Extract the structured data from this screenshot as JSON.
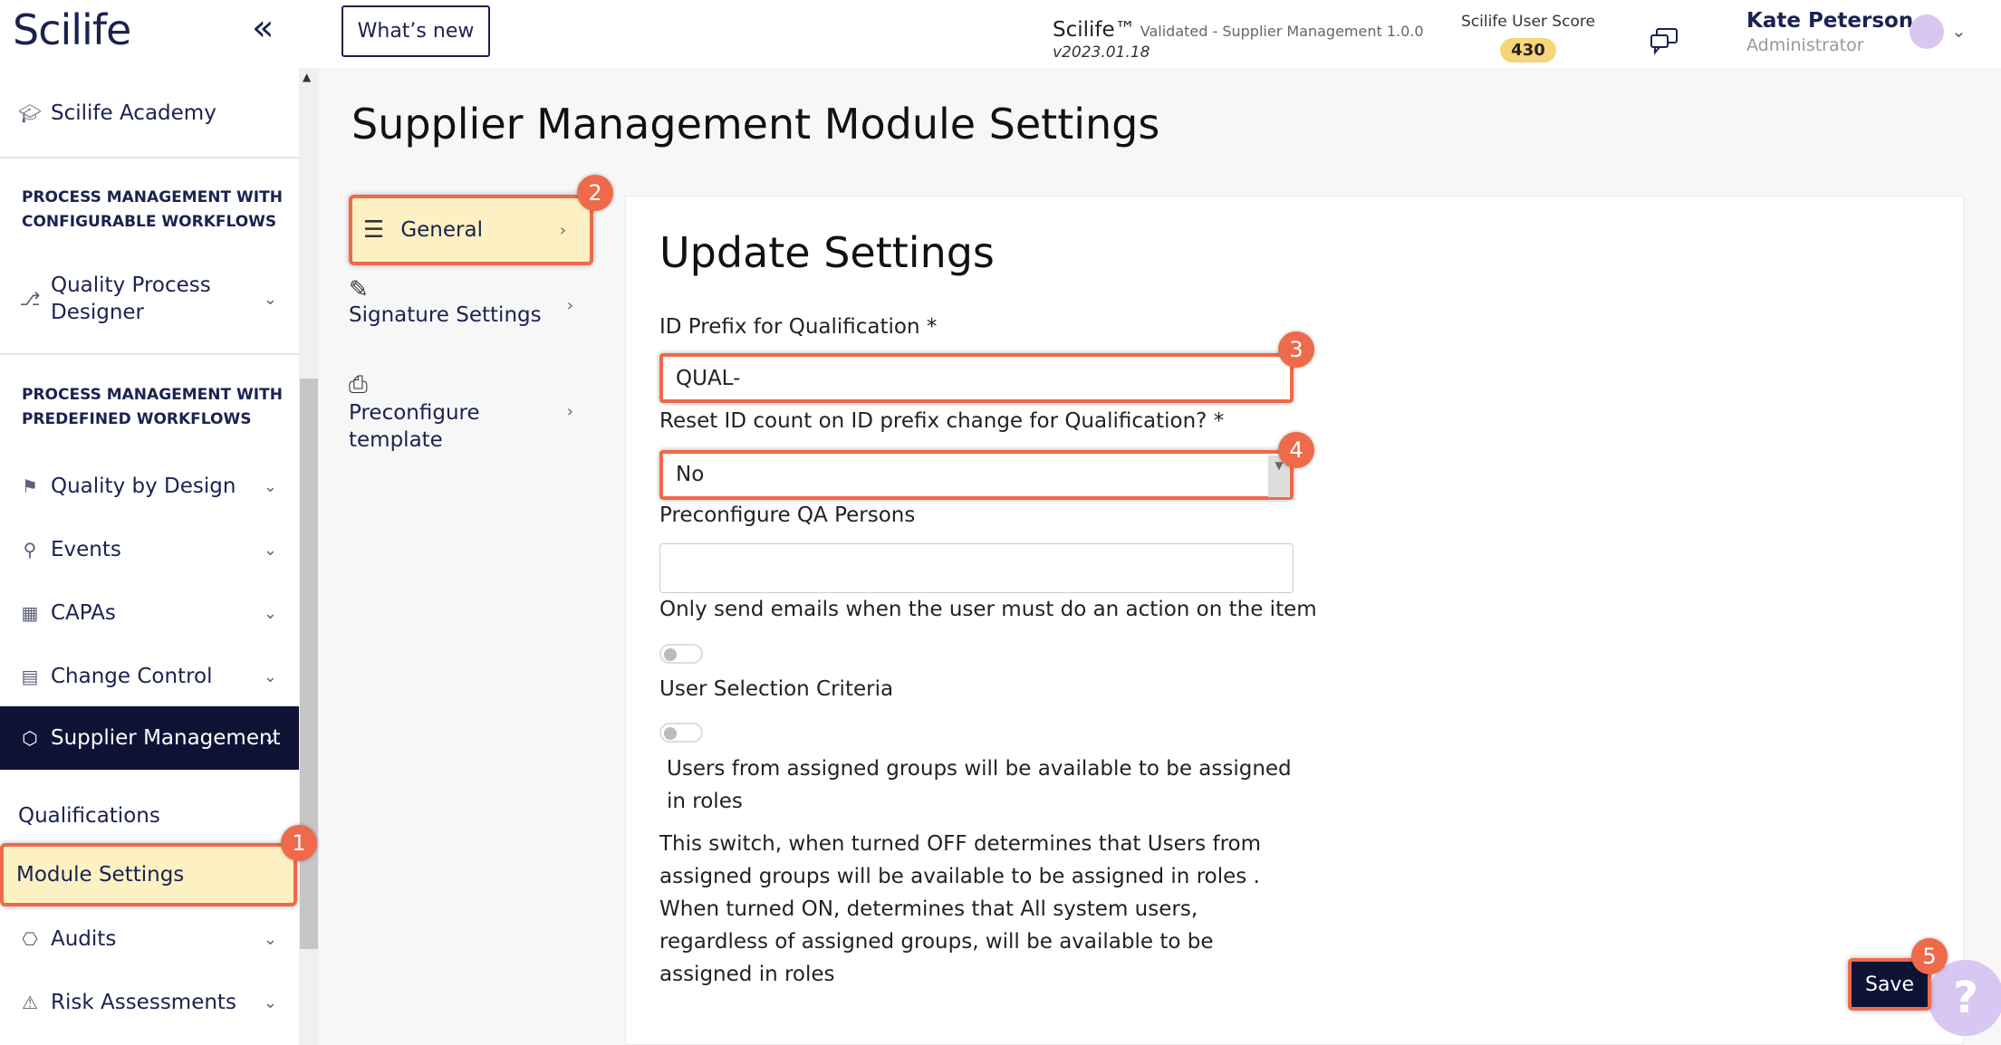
{
  "header": {
    "logo": "Scilife",
    "collapse_icon": "double-chevron-left-icon",
    "whats_new": "What’s new",
    "product_name": "Scilife™",
    "product_sub": "Validated - Supplier Management 1.0.0",
    "product_version": "v2023.01.18",
    "score_label": "Scilife User Score",
    "score_value": "430",
    "user_name": "Kate Peterson",
    "user_role": "Administrator"
  },
  "sidebar": {
    "academy": "Scilife Academy",
    "section1": "PROCESS MANAGEMENT WITH CONFIGURABLE WORKFLOWS",
    "quality_process_designer": "Quality Process Designer",
    "section2": "PROCESS MANAGEMENT WITH PREDEFINED WORKFLOWS",
    "items": [
      "Quality by Design",
      "Events",
      "CAPAs",
      "Change Control",
      "Supplier Management"
    ],
    "sub_items": [
      "Qualifications",
      "Module Settings"
    ],
    "after_items": [
      "Audits",
      "Risk Assessments"
    ]
  },
  "main": {
    "title": "Supplier Management Module Settings",
    "subnav": {
      "general": "General",
      "signature": "Signature Settings",
      "preconfigure": "Preconfigure template"
    },
    "card_title": "Update Settings",
    "fields": {
      "id_prefix_label": "ID Prefix for Qualification *",
      "id_prefix_value": "QUAL-",
      "reset_label": "Reset ID count on ID prefix change for Qualification? *",
      "reset_value": "No",
      "qa_label": "Preconfigure QA Persons",
      "qa_value": "",
      "emails_label": "Only send emails when the user must do an action on the item",
      "user_sel_label": "User Selection Criteria",
      "user_sel_desc": "Users from assigned groups will be available to be assigned in roles",
      "switch_help": "This switch, when turned OFF determines that Users from assigned groups will be available to be assigned in roles . When turned ON, determines that All system users, regardless of assigned groups, will be available to be assigned in roles"
    },
    "save": "Save",
    "help": "?"
  },
  "markers": [
    "1",
    "2",
    "3",
    "4",
    "5"
  ],
  "colors": {
    "navy": "#0e1335",
    "highlight": "#fdf1c4",
    "marker": "#ee6a4a",
    "score_badge": "#f5d67a"
  }
}
